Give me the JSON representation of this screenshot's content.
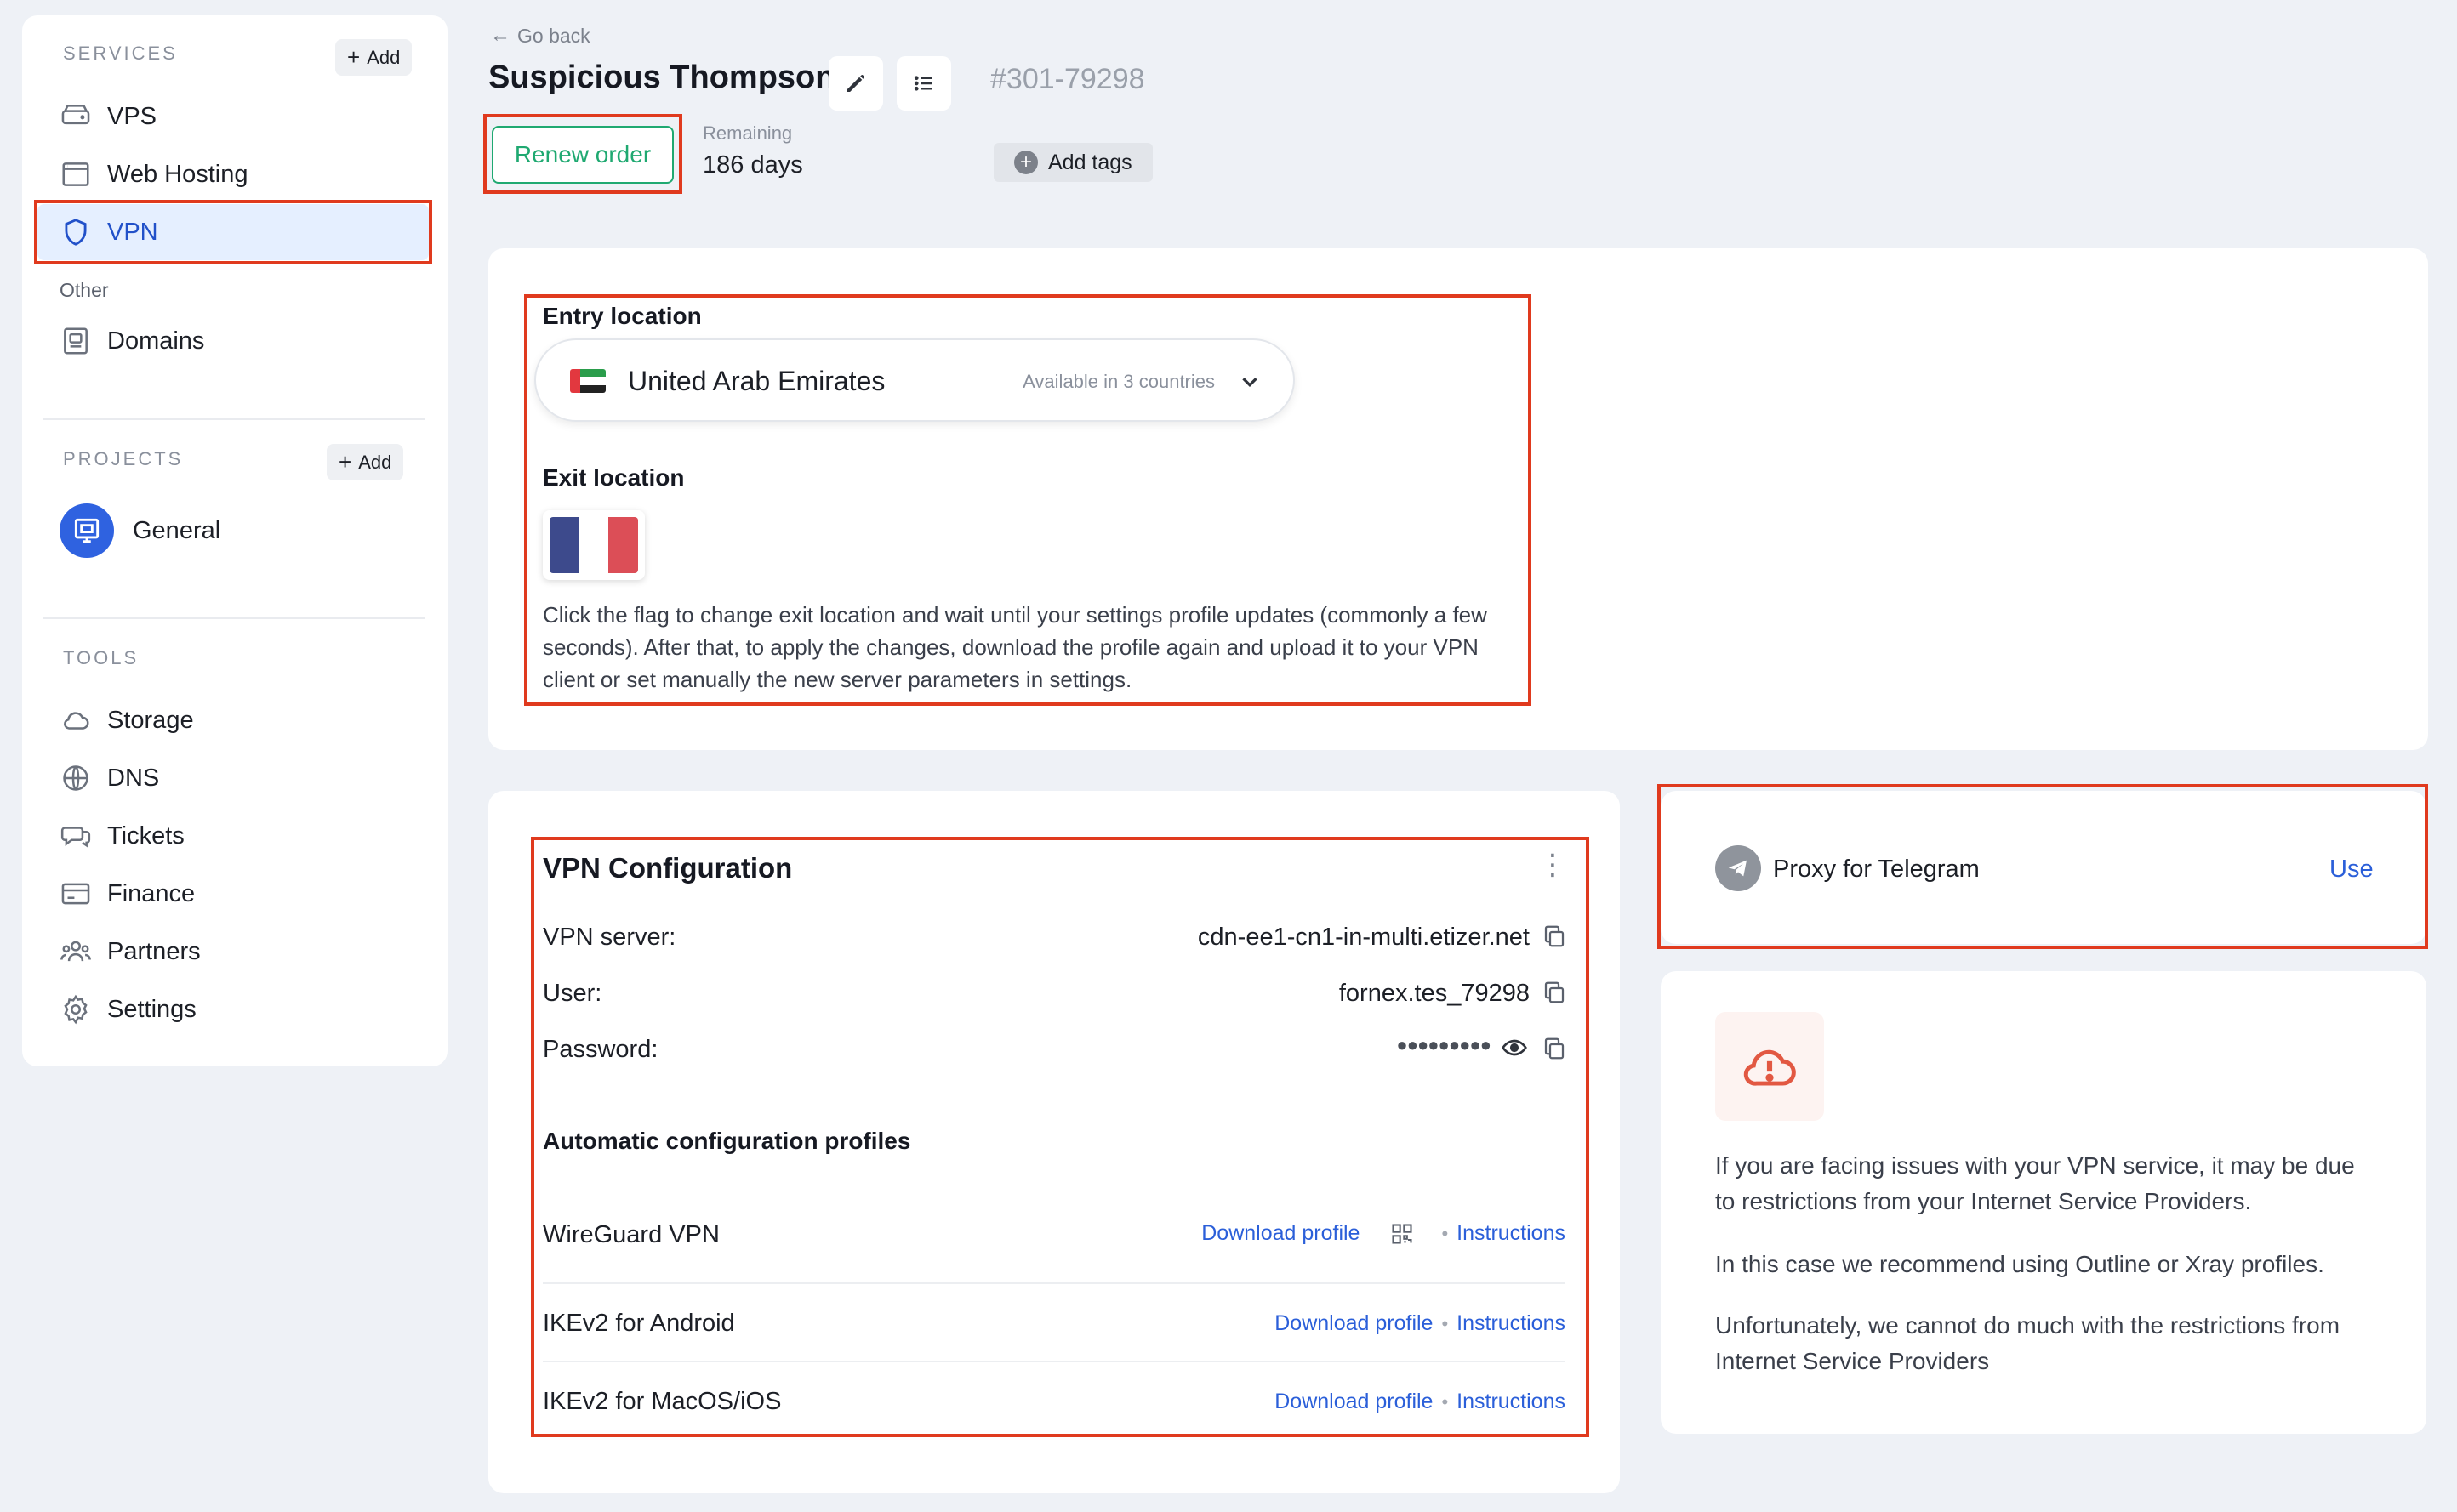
{
  "sidebar": {
    "services_heading": "SERVICES",
    "services_add": "Add",
    "items": [
      {
        "label": "VPS",
        "icon": "server-icon"
      },
      {
        "label": "Web Hosting",
        "icon": "browser-window-icon"
      },
      {
        "label": "VPN",
        "icon": "shield-icon",
        "active": true
      }
    ],
    "other_label": "Other",
    "other_items": [
      {
        "label": "Domains",
        "icon": "domain-document-icon"
      }
    ],
    "projects_heading": "PROJECTS",
    "projects_add": "Add",
    "project": {
      "label": "General",
      "icon": "project-icon"
    },
    "tools_heading": "TOOLS",
    "tools": [
      {
        "label": "Storage",
        "icon": "cloud-icon"
      },
      {
        "label": "DNS",
        "icon": "globe-icon"
      },
      {
        "label": "Tickets",
        "icon": "chat-icon"
      },
      {
        "label": "Finance",
        "icon": "credit-card-icon"
      },
      {
        "label": "Partners",
        "icon": "users-icon"
      },
      {
        "label": "Settings",
        "icon": "gear-icon"
      }
    ]
  },
  "header": {
    "back_label": "Go back",
    "title": "Suspicious Thompson",
    "order_hash": "#",
    "order_id": "301-79298",
    "renew_label": "Renew order",
    "remaining_label": "Remaining",
    "remaining_value": "186 days",
    "add_tags_label": "Add tags"
  },
  "location": {
    "entry_heading": "Entry location",
    "entry_country": "United Arab Emirates",
    "entry_availability": "Available in 3 countries",
    "exit_heading": "Exit location",
    "exit_flag": "France",
    "note": "Click the flag to change exit location and wait until your settings profile updates (commonly a few seconds). After that, to apply the changes, download the profile again and upload it to your VPN client or set manually the new server parameters in settings."
  },
  "vpn_config": {
    "title": "VPN Configuration",
    "server_label": "VPN server:",
    "server_value": "cdn-ee1-cn1-in-multi.etizer.net",
    "user_label": "User:",
    "user_value": "fornex.tes_79298",
    "password_label": "Password:",
    "password_mask": "●●●●●●●●●",
    "profiles_heading": "Automatic configuration profiles",
    "profiles": [
      {
        "name": "WireGuard VPN",
        "download": "Download profile",
        "instructions": "Instructions",
        "qr": true
      },
      {
        "name": "IKEv2 for Android",
        "download": "Download profile",
        "instructions": "Instructions"
      },
      {
        "name": "IKEv2 for MacOS/iOS",
        "download": "Download profile",
        "instructions": "Instructions"
      }
    ]
  },
  "proxy": {
    "label": "Proxy for Telegram",
    "action": "Use"
  },
  "notice": {
    "p1": "If you are facing issues with your VPN service, it may be due to restrictions from your Internet Service Providers.",
    "p2": "In this case we recommend using Outline or Xray profiles.",
    "p3": "Unfortunately, we cannot do much with the restrictions from Internet Service Providers"
  },
  "colors": {
    "accent": "#2b5fd9",
    "highlight": "#e03a1e",
    "renew_green": "#1fa971",
    "page_bg": "#eef1f6"
  }
}
